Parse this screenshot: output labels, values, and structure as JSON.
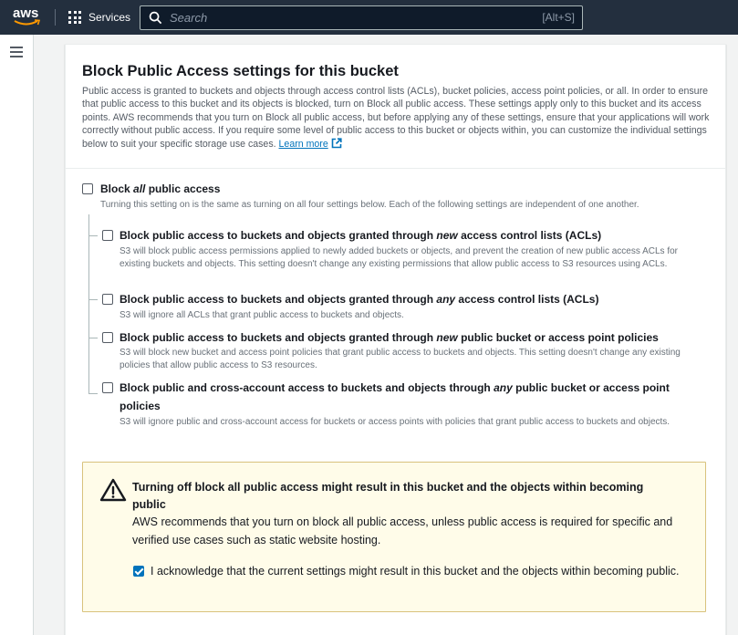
{
  "nav": {
    "logo_text": "aws",
    "services_label": "Services",
    "search_placeholder": "Search",
    "search_shortcut": "[Alt+S]"
  },
  "bpa": {
    "title": "Block Public Access settings for this bucket",
    "description": "Public access is granted to buckets and objects through access control lists (ACLs), bucket policies, access point policies, or all. In order to ensure that public access to this bucket and its objects is blocked, turn on Block all public access. These settings apply only to this bucket and its access points. AWS recommends that you turn on Block all public access, but before applying any of these settings, ensure that your applications will work correctly without public access. If you require some level of public access to this bucket or objects within, you can customize the individual settings below to suit your specific storage use cases.",
    "learn_more": "Learn more",
    "block_all": {
      "label_pre": "Block ",
      "label_em": "all",
      "label_post": " public access",
      "desc": "Turning this setting on is the same as turning on all four settings below. Each of the following settings are independent of one another.",
      "checked": false
    },
    "options": [
      {
        "label_pre": "Block public access to buckets and objects granted through ",
        "label_em": "new",
        "label_post": " access control lists (ACLs)",
        "desc": "S3 will block public access permissions applied to newly added buckets or objects, and prevent the creation of new public access ACLs for existing buckets and objects. This setting doesn't change any existing permissions that allow public access to S3 resources using ACLs.",
        "checked": false
      },
      {
        "label_pre": "Block public access to buckets and objects granted through ",
        "label_em": "any",
        "label_post": " access control lists (ACLs)",
        "desc": "S3 will ignore all ACLs that grant public access to buckets and objects.",
        "checked": false
      },
      {
        "label_pre": "Block public access to buckets and objects granted through ",
        "label_em": "new",
        "label_post": " public bucket or access point policies",
        "desc": "S3 will block new bucket and access point policies that grant public access to buckets and objects. This setting doesn't change any existing policies that allow public access to S3 resources.",
        "checked": false
      },
      {
        "label_pre": "Block public and cross-account access to buckets and objects through ",
        "label_em": "any",
        "label_post": " public bucket or access point",
        "label_line2": "policies",
        "desc": "S3 will ignore public and cross-account access for buckets or access points with policies that grant public access to buckets and objects.",
        "checked": false
      }
    ]
  },
  "warning": {
    "title": "Turning off block all public access might result in this bucket and the objects within becoming public",
    "body": "AWS recommends that you turn on block all public access, unless public access is required for specific and verified use cases such as static website hosting.",
    "ack_label": "I acknowledge that the current settings might result in this bucket and the objects within becoming public.",
    "ack_checked": true
  },
  "colors": {
    "nav_bg": "#232f3e",
    "link": "#0073bb",
    "warning_bg": "#fffce9",
    "warning_border": "#d8c27d",
    "checkbox_checked": "#0073bb"
  }
}
